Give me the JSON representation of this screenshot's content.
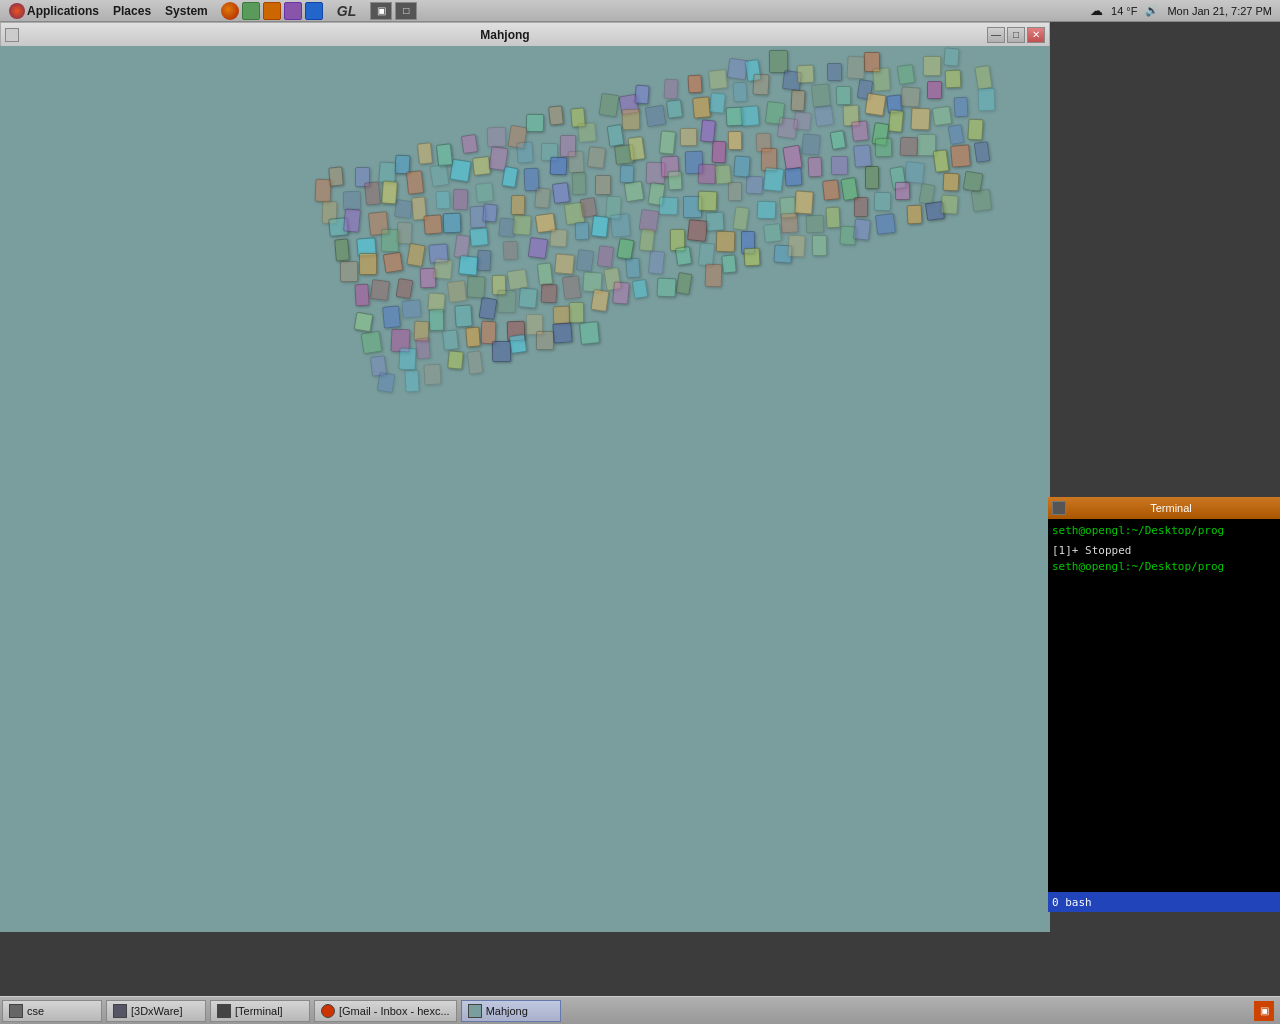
{
  "top_panel": {
    "menu": {
      "applications": "Applications",
      "places": "Places",
      "system": "System"
    },
    "gl_text": "GL",
    "weather": "14 °F",
    "datetime": "Mon Jan 21,  7:27 PM"
  },
  "mahjong_window": {
    "title": "Mahjong",
    "win_controls": {
      "minimize": "—",
      "maximize": "□",
      "close": "✕"
    }
  },
  "terminal_window": {
    "line1": "seth@opengl:~/Desktop/prog",
    "line2": "[1]+  Stopped",
    "line3": "seth@opengl:~/Desktop/prog",
    "bash_label": "0 bash"
  },
  "taskbar": {
    "items": [
      {
        "label": "cse",
        "active": false
      },
      {
        "label": "[3DxWare]",
        "active": false
      },
      {
        "label": "[Terminal]",
        "active": false
      },
      {
        "label": "[Gmail - Inbox - hexc...",
        "active": false
      },
      {
        "label": "Mahjong",
        "active": true
      }
    ]
  }
}
